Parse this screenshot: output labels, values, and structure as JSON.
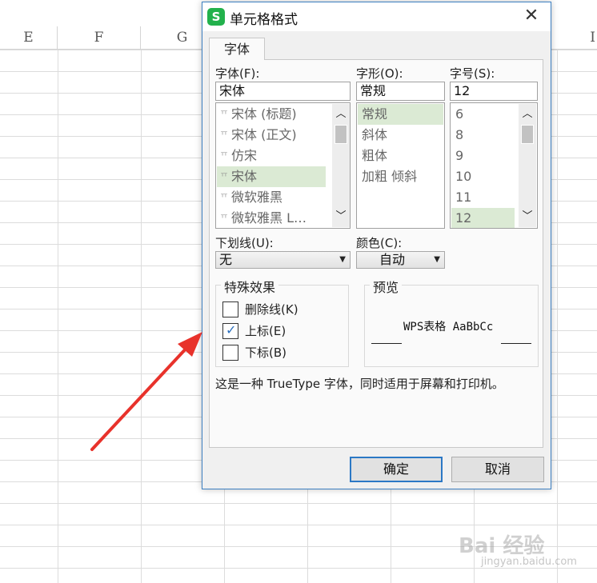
{
  "sheet": {
    "columns": [
      "E",
      "F",
      "G",
      "",
      "",
      "",
      "",
      "I"
    ]
  },
  "dialog": {
    "title": "单元格格式",
    "close_symbol": "✕",
    "tab_font": "字体",
    "font_label": "字体(F):",
    "font_value": "宋体",
    "font_list": [
      {
        "label": "宋体 (标题)",
        "selected": false
      },
      {
        "label": "宋体 (正文)",
        "selected": false
      },
      {
        "label": "仿宋",
        "selected": false
      },
      {
        "label": "宋体",
        "selected": true
      },
      {
        "label": "微软雅黑",
        "selected": false
      },
      {
        "label": "微软雅黑 L…",
        "selected": false
      }
    ],
    "style_label": "字形(O):",
    "style_value": "常规",
    "style_list": [
      {
        "label": "常规",
        "selected": true
      },
      {
        "label": "斜体",
        "selected": false
      },
      {
        "label": "粗体",
        "selected": false
      },
      {
        "label": "加粗 倾斜",
        "selected": false
      }
    ],
    "size_label": "字号(S):",
    "size_value": "12",
    "size_list": [
      {
        "label": "6",
        "selected": false
      },
      {
        "label": "8",
        "selected": false
      },
      {
        "label": "9",
        "selected": false
      },
      {
        "label": "10",
        "selected": false
      },
      {
        "label": "11",
        "selected": false
      },
      {
        "label": "12",
        "selected": true
      }
    ],
    "underline_label": "下划线(U):",
    "underline_value": "无",
    "color_label": "颜色(C):",
    "color_value": "自动",
    "effects_title": "特殊效果",
    "effects": [
      {
        "label": "删除线(K)",
        "checked": false
      },
      {
        "label": "上标(E)",
        "checked": true
      },
      {
        "label": "下标(B)",
        "checked": false
      }
    ],
    "preview_title": "预览",
    "preview_text": "WPS表格  AaBbCc",
    "description": "这是一种 TrueType 字体，同时适用于屏幕和打印机。",
    "ok_label": "确定",
    "cancel_label": "取消",
    "app_icon_letter": "S"
  },
  "watermark": {
    "text": "Bai 经验",
    "sub": "jingyan.baidu.com"
  },
  "colors": {
    "accent": "#2b78c5",
    "selection": "#dbead4",
    "arrow": "#e8322b",
    "app_icon": "#22b14c"
  }
}
